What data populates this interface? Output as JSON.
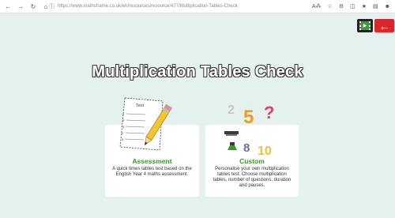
{
  "browser": {
    "url": "https://www.mathsframe.co.uk/en/resources/resource/477/Multiplication-Tables-Check",
    "back_icon": "back-arrow-icon",
    "forward_icon": "forward-arrow-icon",
    "reload_icon": "reload-icon",
    "home_icon": "home-icon"
  },
  "toolbar": {
    "film_icon": "film-icon",
    "exit_icon": "exit-arrow-icon"
  },
  "title": "Multiplication Tables Check",
  "cards": {
    "assessment": {
      "title": "Assessment",
      "description": "A quick times tables test based on the English Year 4 maths assessment.",
      "illustration_text": "Test"
    },
    "custom": {
      "title": "Custom",
      "description": "Personalise your own multiplication tables test. Choose multiplication tables, number of questions, duration and pauses.",
      "illustration_numbers": [
        "2",
        "5",
        "?",
        "8",
        "10"
      ]
    }
  },
  "colors": {
    "background": "#e4f1ef",
    "accent_green": "#3a9a28",
    "exit_red": "#d8282e",
    "number_orange": "#f39c12"
  }
}
